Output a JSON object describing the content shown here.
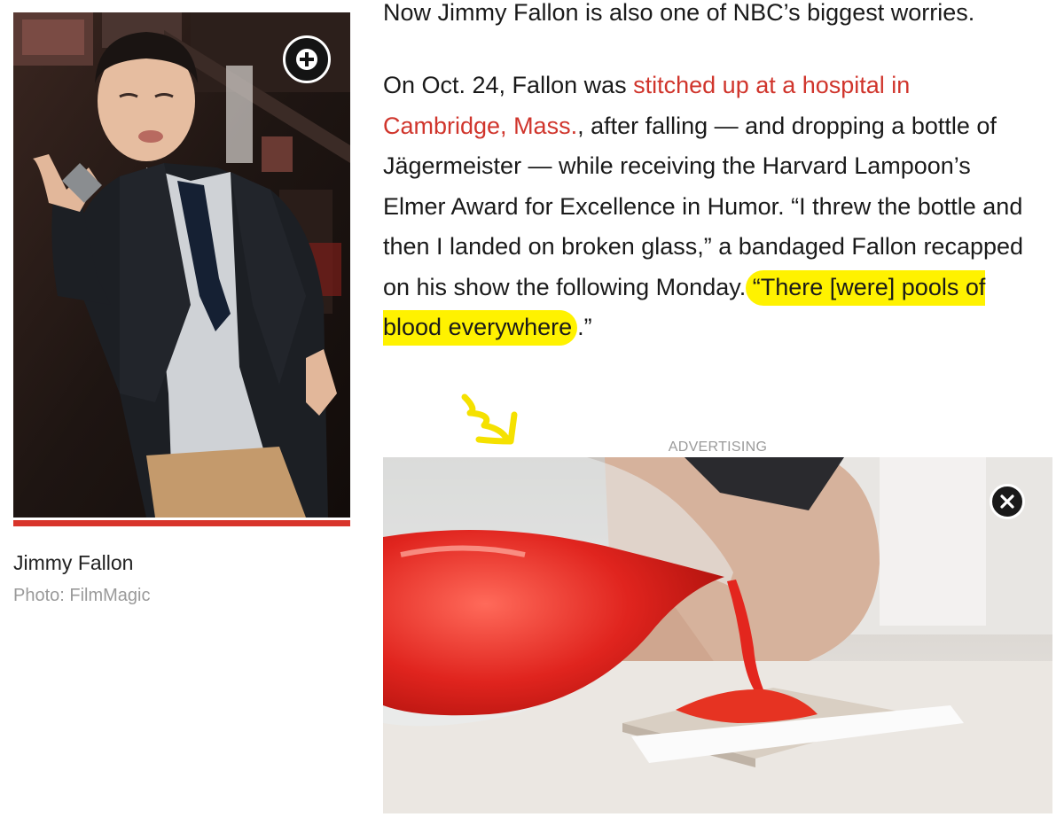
{
  "photo": {
    "caption": "Jimmy Fallon",
    "credit": "Photo: FilmMagic",
    "expand_icon": "plus-circle-icon"
  },
  "article": {
    "para1": "Now Jimmy Fallon is also one of NBC’s biggest worries.",
    "para2": {
      "lead": "On Oct. 24, Fallon was ",
      "link": "stitched up at a hospital in Cambridge, Mass.",
      "middle": ", after falling — and dropping a bottle of Jägermeister — while receiving the Harvard Lampoon’s Elmer Award for Excellence in Humor. “I threw the bottle and then I landed on broken glass,” a bandaged Fallon recapped on his show the following Monday. ",
      "highlight": "“There [were] pools of blood everywhere",
      "tail": ".”"
    }
  },
  "ad": {
    "label": "ADVERTISING",
    "close_icon": "close-icon"
  },
  "colors": {
    "link": "#d0352c",
    "highlight": "#fff200",
    "accent_bar": "#d8352b",
    "scribble": "#f5e100"
  }
}
